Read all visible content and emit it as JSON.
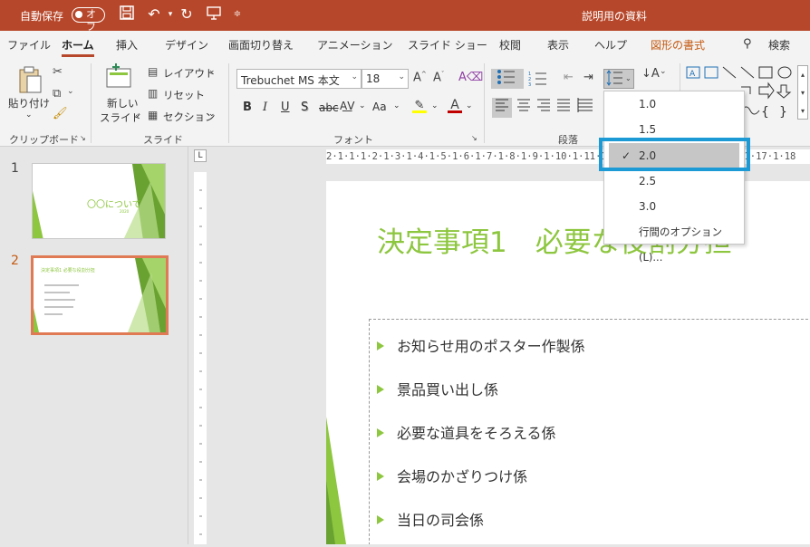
{
  "titlebar": {
    "autosave_label": "自動保存",
    "autosave_state": "オフ",
    "doc_title": "説明用の資料"
  },
  "tabs": [
    {
      "label": "ファイル"
    },
    {
      "label": "ホーム"
    },
    {
      "label": "挿入"
    },
    {
      "label": "デザイン"
    },
    {
      "label": "画面切り替え"
    },
    {
      "label": "アニメーション"
    },
    {
      "label": "スライド ショー"
    },
    {
      "label": "校閲"
    },
    {
      "label": "表示"
    },
    {
      "label": "ヘルプ"
    },
    {
      "label": "図形の書式"
    }
  ],
  "search_label": "検索",
  "ribbon": {
    "clipboard": {
      "paste_label": "貼り付け",
      "group_label": "クリップボード"
    },
    "slides": {
      "new_slide_label1": "新しい",
      "new_slide_label2": "スライド",
      "layout_label": "レイアウト",
      "reset_label": "リセット",
      "section_label": "セクション",
      "group_label": "スライド"
    },
    "font": {
      "font_name": "Trebuchet MS 本文",
      "font_size": "18",
      "group_label": "フォント",
      "bold": "B",
      "italic": "I",
      "underline": "U",
      "shadow": "S",
      "strike": "abc",
      "case": "Aa"
    },
    "paragraph": {
      "group_label": "段落"
    }
  },
  "line_spacing_menu": {
    "items": [
      "1.0",
      "1.5",
      "2.0",
      "2.5",
      "3.0"
    ],
    "selected": "2.0",
    "options_label": "行間のオプション(L)..."
  },
  "slides_pane": [
    {
      "number": "1",
      "thumb_title": "〇〇について",
      "thumb_subtitle": "2020"
    },
    {
      "number": "2",
      "thumb_title": "決定事項1 必要な役割分担"
    }
  ],
  "slide": {
    "title": "決定事項1　必要な役割分担",
    "bullets": [
      "お知らせ用のポスター作製係",
      "景品買い出し係",
      "必要な道具をそろえる係",
      "会場のかざりつけ係",
      "当日の司会係"
    ]
  },
  "ruler_ticks": "2·1·1·1·2·1·3·1·4·1·5·1·6·1·7·1·8·1·9·1·10·1·11·1·12·1·13·1·14·1·15·1·16·1·17·1·18",
  "colors": {
    "accent": "#b7472a",
    "slide_green": "#8dc63f",
    "highlight": "#1b9ad6"
  }
}
